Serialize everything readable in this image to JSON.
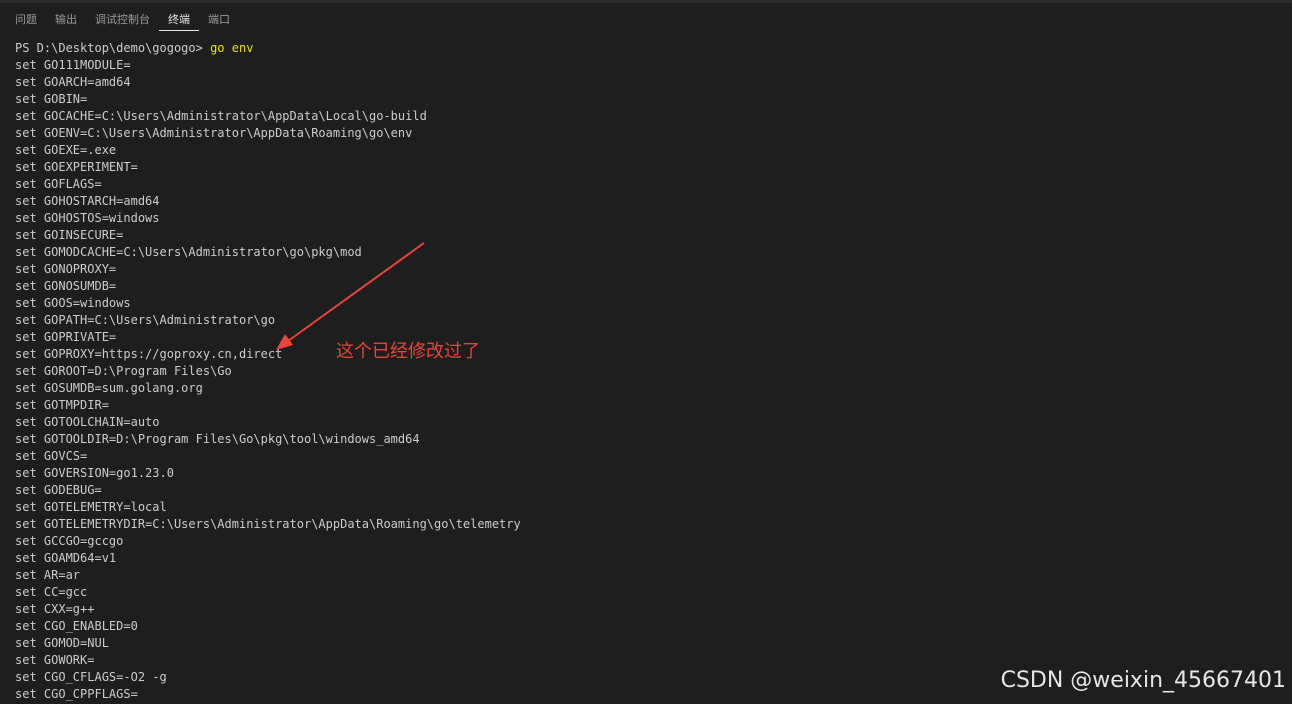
{
  "tabs": [
    {
      "label": "问题"
    },
    {
      "label": "输出"
    },
    {
      "label": "调试控制台"
    },
    {
      "label": "终端",
      "active": true
    },
    {
      "label": "端口"
    }
  ],
  "terminal": {
    "prompt": "PS D:\\Desktop\\demo\\gogogo> ",
    "command": "go env",
    "lines": [
      "set GO111MODULE=",
      "set GOARCH=amd64",
      "set GOBIN=",
      "set GOCACHE=C:\\Users\\Administrator\\AppData\\Local\\go-build",
      "set GOENV=C:\\Users\\Administrator\\AppData\\Roaming\\go\\env",
      "set GOEXE=.exe",
      "set GOEXPERIMENT=",
      "set GOFLAGS=",
      "set GOHOSTARCH=amd64",
      "set GOHOSTOS=windows",
      "set GOINSECURE=",
      "set GOMODCACHE=C:\\Users\\Administrator\\go\\pkg\\mod",
      "set GONOPROXY=",
      "set GONOSUMDB=",
      "set GOOS=windows",
      "set GOPATH=C:\\Users\\Administrator\\go",
      "set GOPRIVATE=",
      "set GOPROXY=https://goproxy.cn,direct",
      "set GOROOT=D:\\Program Files\\Go",
      "set GOSUMDB=sum.golang.org",
      "set GOTMPDIR=",
      "set GOTOOLCHAIN=auto",
      "set GOTOOLDIR=D:\\Program Files\\Go\\pkg\\tool\\windows_amd64",
      "set GOVCS=",
      "set GOVERSION=go1.23.0",
      "set GODEBUG=",
      "set GOTELEMETRY=local",
      "set GOTELEMETRYDIR=C:\\Users\\Administrator\\AppData\\Roaming\\go\\telemetry",
      "set GCCGO=gccgo",
      "set GOAMD64=v1",
      "set AR=ar",
      "set CC=gcc",
      "set CXX=g++",
      "set CGO_ENABLED=0",
      "set GOMOD=NUL",
      "set GOWORK=",
      "set CGO_CFLAGS=-O2 -g",
      "set CGO_CPPFLAGS="
    ]
  },
  "annotation": {
    "text": "这个已经修改过了",
    "color": "#e8443a"
  },
  "watermark": "CSDN @weixin_45667401",
  "colors": {
    "background": "#1e1e1e",
    "text": "#cccccc",
    "command": "#e5e510"
  }
}
